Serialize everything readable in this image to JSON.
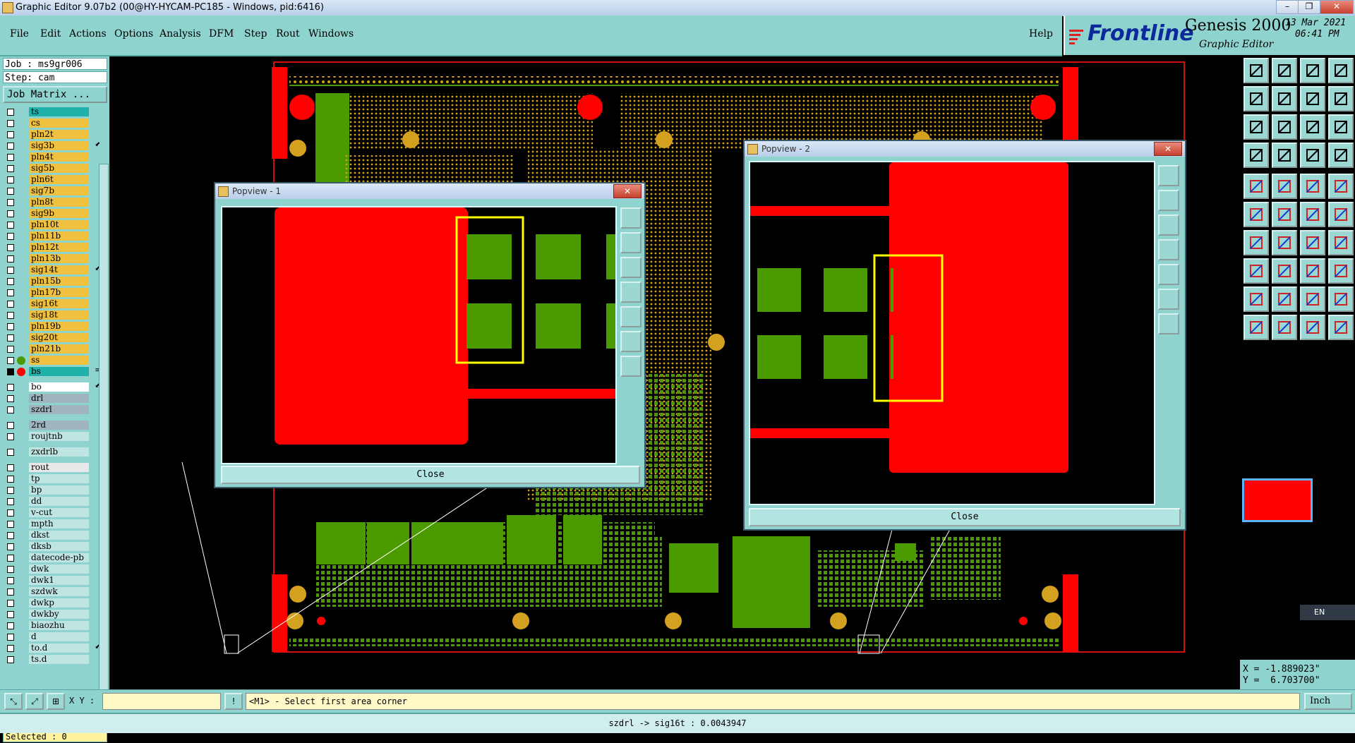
{
  "window": {
    "title": "Graphic Editor 9.07b2 (00@HY-HYCAM-PC185 - Windows, pid:6416)",
    "min_label": "–",
    "restore_label": "❐",
    "close_label": "✕"
  },
  "menu": {
    "items": [
      "File",
      "Edit",
      "Actions",
      "Options",
      "Analysis",
      "DFM",
      "Step",
      "Rout",
      "Windows"
    ],
    "help": "Help"
  },
  "brand": {
    "company": "Frontline",
    "product": "Genesis 2000",
    "subtitle": "Graphic Editor",
    "date": "13 Mar 2021",
    "time": "06:41 PM"
  },
  "job": {
    "job": "Job : ms9gr006",
    "step": "Step: cam",
    "matrix_button": "Job Matrix ..."
  },
  "layers": [
    {
      "name": "ts",
      "color": "#20b2aa",
      "marker": ""
    },
    {
      "name": "cs",
      "color": "#f0c040",
      "marker": ""
    },
    {
      "name": "pln2t",
      "color": "#f0c040",
      "marker": ""
    },
    {
      "name": "sig3b",
      "color": "#f0c040",
      "marker": "⬋"
    },
    {
      "name": "pln4t",
      "color": "#f0c040",
      "marker": ""
    },
    {
      "name": "sig5b",
      "color": "#f0c040",
      "marker": ""
    },
    {
      "name": "pln6t",
      "color": "#f0c040",
      "marker": ""
    },
    {
      "name": "sig7b",
      "color": "#f0c040",
      "marker": ""
    },
    {
      "name": "pln8t",
      "color": "#f0c040",
      "marker": ""
    },
    {
      "name": "sig9b",
      "color": "#f0c040",
      "marker": ""
    },
    {
      "name": "pln10t",
      "color": "#f0c040",
      "marker": ""
    },
    {
      "name": "pln11b",
      "color": "#f0c040",
      "marker": ""
    },
    {
      "name": "pln12t",
      "color": "#f0c040",
      "marker": ""
    },
    {
      "name": "pln13b",
      "color": "#f0c040",
      "marker": ""
    },
    {
      "name": "sig14t",
      "color": "#f0c040",
      "marker": "⬋"
    },
    {
      "name": "pln15b",
      "color": "#f0c040",
      "marker": ""
    },
    {
      "name": "pln17b",
      "color": "#f0c040",
      "marker": ""
    },
    {
      "name": "sig16t",
      "color": "#f0c040",
      "marker": ""
    },
    {
      "name": "sig18t",
      "color": "#f0c040",
      "marker": ""
    },
    {
      "name": "pln19b",
      "color": "#f0c040",
      "marker": ""
    },
    {
      "name": "sig20t",
      "color": "#f0c040",
      "marker": ""
    },
    {
      "name": "pln21b",
      "color": "#f0c040",
      "marker": ""
    },
    {
      "name": "ss",
      "color": "#f0c040",
      "marker": ""
    },
    {
      "name": "bs",
      "color": "#20b2aa",
      "marker": "≡"
    },
    {
      "name": "bo",
      "color": "#ffffff",
      "marker": "⬋"
    },
    {
      "name": "drl",
      "color": "#9fb4bd",
      "marker": ""
    },
    {
      "name": "szdrl",
      "color": "#9fb4bd",
      "marker": ""
    },
    {
      "name": "2rd",
      "color": "#9fb4bd",
      "marker": ""
    },
    {
      "name": "roujtnb",
      "color": "#bfe5e2",
      "marker": ""
    },
    {
      "name": "zxdrlb",
      "color": "#bfe5e2",
      "marker": ""
    },
    {
      "name": "rout",
      "color": "#e8e8e8",
      "marker": ""
    },
    {
      "name": "tp",
      "color": "#bfe5e2",
      "marker": ""
    },
    {
      "name": "bp",
      "color": "#bfe5e2",
      "marker": ""
    },
    {
      "name": "dd",
      "color": "#bfe5e2",
      "marker": ""
    },
    {
      "name": "v-cut",
      "color": "#bfe5e2",
      "marker": ""
    },
    {
      "name": "mpth",
      "color": "#bfe5e2",
      "marker": ""
    },
    {
      "name": "dkst",
      "color": "#bfe5e2",
      "marker": ""
    },
    {
      "name": "dksb",
      "color": "#bfe5e2",
      "marker": ""
    },
    {
      "name": "datecode-pb",
      "color": "#bfe5e2",
      "marker": ""
    },
    {
      "name": "dwk",
      "color": "#bfe5e2",
      "marker": ""
    },
    {
      "name": "dwk1",
      "color": "#bfe5e2",
      "marker": ""
    },
    {
      "name": "szdwk",
      "color": "#bfe5e2",
      "marker": ""
    },
    {
      "name": "dwkp",
      "color": "#bfe5e2",
      "marker": ""
    },
    {
      "name": "dwkby",
      "color": "#bfe5e2",
      "marker": ""
    },
    {
      "name": "biaozhu",
      "color": "#bfe5e2",
      "marker": ""
    },
    {
      "name": "d",
      "color": "#bfe5e2",
      "marker": ""
    },
    {
      "name": "to.d",
      "color": "#bfe5e2",
      "marker": "⬋"
    },
    {
      "name": "ts.d",
      "color": "#bfe5e2",
      "marker": ""
    }
  ],
  "selected": "Selected : 0",
  "popview1": {
    "title": "Popview - 1",
    "close_button": "Close"
  },
  "popview2": {
    "title": "Popview - 2",
    "close_button": "Close"
  },
  "coords": {
    "x": "X = -1.889023\"",
    "y": "Y =  6.703700\""
  },
  "ime": "EN",
  "command": {
    "xy_label": "X Y :",
    "xy_value": "",
    "prompt": "<M1> - Select first area corner",
    "units": "Inch"
  },
  "status": "szdrl -> sig16t : 0.0043947",
  "colors": {
    "panel": "#8fd3cf",
    "copper": "#4a9a00",
    "red": "#ff0000",
    "pad": "#d4a020",
    "highlight": "#ffff00"
  }
}
